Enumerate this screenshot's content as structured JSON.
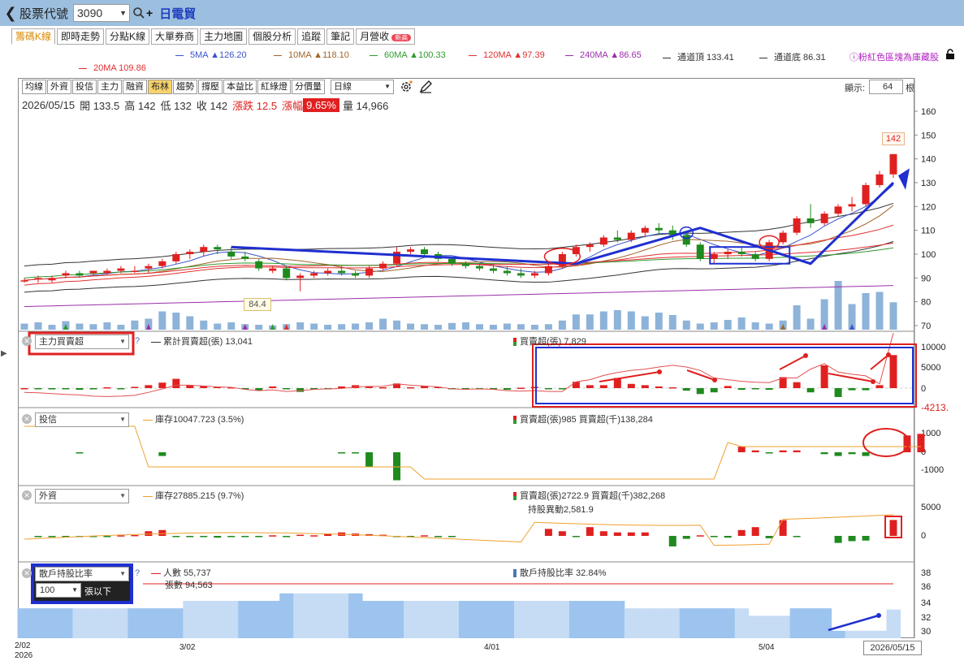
{
  "header": {
    "stock_code_label": "股票代號",
    "stock_code_value": "3090",
    "stock_name": "日電貿"
  },
  "tabs": [
    {
      "label": "籌碼K線",
      "active": true
    },
    {
      "label": "即時走勢"
    },
    {
      "label": "分點K線"
    },
    {
      "label": "大單券商"
    },
    {
      "label": "主力地圖"
    },
    {
      "label": "個股分析"
    },
    {
      "label": "追蹤"
    },
    {
      "label": "筆記"
    },
    {
      "label": "月營收",
      "badge": "新高"
    }
  ],
  "ma_legend": [
    {
      "label": "5MA ▲126.20",
      "color": "#3a54c8"
    },
    {
      "label": "10MA ▲118.10",
      "color": "#a0642a"
    },
    {
      "label": "60MA ▲100.33",
      "color": "#2f9a2f"
    },
    {
      "label": "120MA ▲97.39",
      "color": "#e03030"
    },
    {
      "label": "240MA ▲86.65",
      "color": "#9a2fa8"
    },
    {
      "label": "通道頂 133.41",
      "color": "#333333"
    },
    {
      "label": "通道底 86.31",
      "color": "#333333"
    }
  ],
  "ma_row2": "20MA 109.86",
  "ma_note": "ⓘ粉紅色區塊為庫藏股",
  "toolbar": {
    "buttons": [
      "均線",
      "外資",
      "投信",
      "主力",
      "融資",
      "布林",
      "趨勢",
      "撐壓",
      "本益比",
      "紅綠燈",
      "分價量"
    ],
    "active": "布林",
    "period": "日線",
    "display_label": "顯示:",
    "display_value": "64",
    "display_unit": "根"
  },
  "quote": {
    "date": "2026/05/15",
    "open": "開 133.5",
    "high": "高 142",
    "low": "低 132",
    "close": "收 142",
    "change": "漲跌 12.5",
    "pct_label": "漲幅",
    "pct": "9.65%",
    "volume": "量 14,966"
  },
  "price_axis": [
    "160",
    "150",
    "140",
    "130",
    "120",
    "110",
    "100",
    "90",
    "80",
    "70"
  ],
  "price_tag": "142",
  "low_tag": "84.4",
  "panels": {
    "main_force": {
      "select": "主力買賣超",
      "legend1": "累計買賣超(張) 13,041",
      "legend2": "買賣超(張) 7,829",
      "axis": [
        "10000",
        "5000",
        "0",
        "-4213."
      ]
    },
    "trust": {
      "select": "投信",
      "legend1": "庫存10047.723 (3.5%)",
      "legend2": "買賣超(張)985 買賣超(千)138,284",
      "axis": [
        "1000",
        "0",
        "-1000"
      ]
    },
    "foreign": {
      "select": "外資",
      "legend1": "庫存27885.215 (9.7%)",
      "legend2": "買賣超(張)2722.9 買賣超(千)382,268",
      "legend3": "持股異動2,581.9",
      "axis": [
        "5000",
        "0"
      ]
    },
    "retail": {
      "select": "散戶持股比率",
      "sub_value": "100",
      "sub_unit": "張以下",
      "legend1": "人數 55,737",
      "legend1b": "張數 94,563",
      "legend2": "散戶持股比率 32.84%",
      "axis": [
        "38",
        "36",
        "34",
        "32",
        "30"
      ]
    }
  },
  "x_axis": [
    {
      "label": "2/02",
      "sub": "2026"
    },
    {
      "label": "3/02"
    },
    {
      "label": "4/01"
    },
    {
      "label": "5/04"
    }
  ],
  "last_date": "2026/05/15",
  "chart_data": {
    "type": "candlestick",
    "dates_shown": [
      "2/02",
      "3/02",
      "4/01",
      "5/04",
      "2026/05/15"
    ],
    "close_last": 142,
    "ohlc_last": {
      "open": 133.5,
      "high": 142,
      "low": 132,
      "close": 142
    },
    "candles": [
      [
        89,
        90,
        88,
        89
      ],
      [
        90,
        91,
        88,
        90
      ],
      [
        89,
        91,
        88,
        90
      ],
      [
        91,
        93,
        90,
        92
      ],
      [
        92,
        93,
        90,
        91
      ],
      [
        92,
        93,
        91,
        93
      ],
      [
        92,
        94,
        91,
        93
      ],
      [
        93,
        95,
        92,
        94
      ],
      [
        93,
        95,
        92,
        93
      ],
      [
        94,
        96,
        92,
        95
      ],
      [
        95,
        98,
        94,
        97
      ],
      [
        97,
        101,
        96,
        100
      ],
      [
        100,
        102,
        98,
        101
      ],
      [
        101,
        104,
        99,
        103
      ],
      [
        103,
        104,
        100,
        102
      ],
      [
        101,
        103,
        98,
        99
      ],
      [
        99,
        101,
        97,
        98
      ],
      [
        97,
        98,
        93,
        94
      ],
      [
        93,
        95,
        92,
        94
      ],
      [
        94,
        95,
        89,
        90
      ],
      [
        90,
        92,
        84.4,
        91
      ],
      [
        91,
        93,
        90,
        92
      ],
      [
        92,
        94,
        91,
        93
      ],
      [
        93,
        95,
        91,
        92
      ],
      [
        92,
        93,
        90,
        91
      ],
      [
        91,
        95,
        90,
        94
      ],
      [
        94,
        97,
        93,
        96
      ],
      [
        96,
        103,
        95,
        101
      ],
      [
        101,
        103,
        100,
        102
      ],
      [
        102,
        103,
        99,
        100
      ],
      [
        100,
        101,
        97,
        98
      ],
      [
        98,
        99,
        95,
        96
      ],
      [
        96,
        97,
        94,
        95
      ],
      [
        95,
        96,
        93,
        94
      ],
      [
        94,
        96,
        92,
        93
      ],
      [
        93,
        95,
        91,
        92
      ],
      [
        92,
        94,
        90,
        91
      ],
      [
        91,
        93,
        90,
        92
      ],
      [
        92,
        96,
        91,
        95
      ],
      [
        95,
        101,
        94,
        100
      ],
      [
        100,
        104,
        99,
        103
      ],
      [
        103,
        105,
        101,
        104
      ],
      [
        104,
        108,
        103,
        107
      ],
      [
        107,
        110,
        105,
        106
      ],
      [
        106,
        110,
        105,
        109
      ],
      [
        109,
        112,
        107,
        111
      ],
      [
        111,
        113,
        108,
        110
      ],
      [
        110,
        112,
        106,
        108
      ],
      [
        108,
        109,
        103,
        104
      ],
      [
        104,
        105,
        97,
        98
      ],
      [
        98,
        101,
        96,
        100
      ],
      [
        100,
        102,
        98,
        101
      ],
      [
        101,
        103,
        99,
        100
      ],
      [
        100,
        101,
        97,
        98
      ],
      [
        98,
        106,
        97,
        105
      ],
      [
        105,
        110,
        104,
        109
      ],
      [
        109,
        116,
        108,
        115
      ],
      [
        115,
        121,
        111,
        113
      ],
      [
        113,
        118,
        112,
        117
      ],
      [
        117,
        121,
        116,
        120
      ],
      [
        120,
        124,
        118,
        121
      ],
      [
        121,
        130,
        120,
        129
      ],
      [
        129,
        135,
        128,
        133.5
      ],
      [
        133.5,
        142,
        132,
        142
      ]
    ],
    "volume": [
      10,
      12,
      8,
      14,
      10,
      9,
      12,
      8,
      15,
      18,
      30,
      28,
      22,
      15,
      10,
      12,
      9,
      8,
      7,
      9,
      12,
      10,
      8,
      9,
      10,
      12,
      18,
      15,
      10,
      9,
      8,
      11,
      12,
      9,
      8,
      10,
      9,
      8,
      9,
      15,
      25,
      25,
      30,
      32,
      30,
      22,
      28,
      24,
      15,
      10,
      12,
      16,
      20,
      12,
      10,
      15,
      40,
      18,
      50,
      80,
      42,
      60,
      62,
      45
    ],
    "volume_markers": [
      {
        "index": 3,
        "color": "#2f9a2f"
      },
      {
        "index": 9,
        "color": "#9a2fa8"
      },
      {
        "index": 16,
        "color": "#9a2fa8"
      },
      {
        "index": 18,
        "color": "#2f9a2f"
      },
      {
        "index": 19,
        "color": "#e03030"
      },
      {
        "index": 55,
        "color": "#9a6b2f"
      },
      {
        "index": 58,
        "color": "#9a2fa8"
      },
      {
        "index": 60,
        "color": "#3a54c8"
      }
    ],
    "main_force_net": [
      0,
      -200,
      -300,
      -250,
      -400,
      -300,
      200,
      -100,
      300,
      700,
      1300,
      2200,
      700,
      500,
      300,
      200,
      -100,
      -600,
      400,
      -200,
      -900,
      -300,
      -200,
      400,
      700,
      400,
      200,
      1100,
      200,
      500,
      300,
      -200,
      -300,
      -200,
      -100,
      -400,
      100,
      300,
      -200,
      -100,
      1500,
      700,
      700,
      2400,
      1000,
      700,
      400,
      200,
      -600,
      -1400,
      -1000,
      500,
      -400,
      -200,
      -400,
      2600,
      1400,
      -1000,
      5400,
      -2100,
      -500,
      -500,
      700,
      7829
    ],
    "main_force_cum": [
      -1000,
      -1100,
      -1300,
      -1500,
      -1600,
      -1900,
      -2000,
      -1900,
      -1700,
      -1000,
      -200,
      700,
      700,
      500,
      300,
      200,
      -300,
      -600,
      -400,
      -800,
      -600,
      -300,
      -200,
      -100,
      300,
      400,
      400,
      1000,
      700,
      500,
      300,
      -200,
      -300,
      -200,
      -300,
      -600,
      -700,
      -600,
      -800,
      -800,
      1500,
      2000,
      3000,
      3700,
      4200,
      4500,
      5000,
      5400,
      5000,
      4200,
      2400,
      2000,
      1600,
      1400,
      1300,
      2400,
      2400,
      4500,
      5800,
      3800,
      3300,
      2900,
      1000,
      13041
    ],
    "trust_net": [
      0,
      0,
      0,
      0,
      -50,
      0,
      0,
      0,
      0,
      0,
      -200,
      0,
      0,
      0,
      0,
      0,
      0,
      0,
      0,
      0,
      0,
      0,
      0,
      -50,
      -50,
      -800,
      0,
      -1500,
      0,
      0,
      0,
      0,
      0,
      0,
      0,
      0,
      0,
      0,
      0,
      0,
      0,
      0,
      0,
      0,
      0,
      0,
      0,
      0,
      0,
      0,
      0,
      0,
      300,
      100,
      -50,
      100,
      100,
      0,
      -100,
      -200,
      -100,
      -200,
      0,
      0,
      900,
      985
    ],
    "trust_inventory_pct": 3.5,
    "foreign_net": [
      0,
      -100,
      -100,
      -100,
      -150,
      -100,
      -50,
      100,
      150,
      800,
      1000,
      -100,
      -100,
      -150,
      -300,
      -200,
      -100,
      -200,
      100,
      -200,
      200,
      100,
      400,
      600,
      400,
      300,
      200,
      -200,
      -100,
      100,
      -100,
      -100,
      0,
      0,
      0,
      0,
      0,
      0,
      1200,
      800,
      -100,
      1500,
      800,
      600,
      600,
      600,
      0,
      -1800,
      -500,
      100,
      -200,
      -300,
      1000,
      1500,
      -400,
      2700,
      -200,
      0,
      0,
      -1200,
      -900,
      -800,
      0,
      2722.9
    ],
    "retail_holder_pct_bands": [
      33,
      33,
      33,
      33,
      33,
      33,
      33,
      33,
      33,
      33,
      33,
      33,
      34,
      34,
      34,
      34,
      34,
      34,
      34,
      35,
      35,
      35,
      35,
      35,
      35,
      34,
      34,
      34,
      34,
      34,
      34,
      34,
      34,
      34,
      34,
      34,
      34,
      34,
      34,
      34,
      34,
      34,
      34,
      34,
      33,
      33,
      33,
      33,
      33,
      33,
      33,
      33,
      33,
      32,
      32,
      32,
      33,
      33,
      33,
      30,
      30,
      30,
      30,
      32.84
    ],
    "retail_count_line": 36.2,
    "price_ylim": [
      70,
      160
    ]
  }
}
